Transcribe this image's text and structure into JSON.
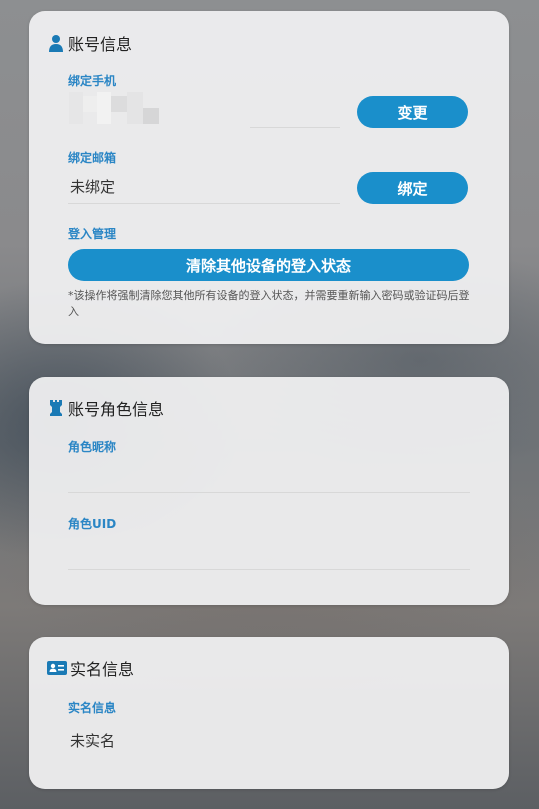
{
  "account_card": {
    "title": "账号信息",
    "phone_label": "绑定手机",
    "change_button": "变更",
    "email_label": "绑定邮箱",
    "email_value": "未绑定",
    "bind_button": "绑定",
    "login_label": "登入管理",
    "clear_button": "清除其他设备的登入状态",
    "note": "*该操作将强制清除您其他所有设备的登入状态，并需要重新输入密码或验证码后登入"
  },
  "role_card": {
    "title": "账号角色信息",
    "nickname_label": "角色昵称",
    "nickname_value": "",
    "uid_label": "角色UID",
    "uid_value": ""
  },
  "realname_card": {
    "title": "实名信息",
    "realname_label": "实名信息",
    "realname_value": "未实名"
  },
  "colors": {
    "accent": "#1a8fcb",
    "label": "#2b86c5",
    "icon": "#1a7ab5"
  },
  "icons": {
    "account": "person-icon",
    "role": "chess-rook-icon",
    "realname": "id-card-icon"
  }
}
